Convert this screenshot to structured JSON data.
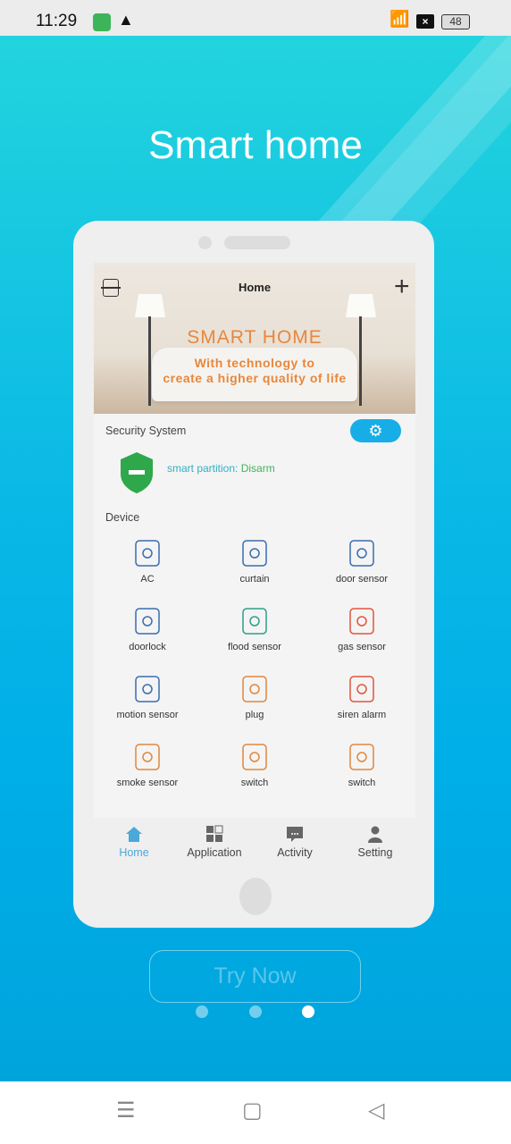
{
  "status_bar": {
    "time": "11:29",
    "battery": "48"
  },
  "title": "Smart home",
  "app": {
    "header_title": "Home",
    "banner": {
      "headline": "SMART HOME",
      "tagline_1": "With technology to",
      "tagline_2": "create a higher quality of life"
    },
    "security": {
      "label": "Security System",
      "partition_label": "smart partition:",
      "partition_state": "Disarm"
    },
    "device_label": "Device",
    "devices": [
      {
        "label": "AC",
        "icon": "ac-icon"
      },
      {
        "label": "curtain",
        "icon": "curtain-icon"
      },
      {
        "label": "door sensor",
        "icon": "door-sensor-icon"
      },
      {
        "label": "doorlock",
        "icon": "doorlock-icon"
      },
      {
        "label": "flood sensor",
        "icon": "flood-sensor-icon"
      },
      {
        "label": "gas sensor",
        "icon": "gas-sensor-icon"
      },
      {
        "label": "motion sensor",
        "icon": "motion-sensor-icon"
      },
      {
        "label": "plug",
        "icon": "plug-icon"
      },
      {
        "label": "siren alarm",
        "icon": "siren-alarm-icon"
      },
      {
        "label": "smoke sensor",
        "icon": "smoke-sensor-icon"
      },
      {
        "label": "switch",
        "icon": "switch-icon"
      },
      {
        "label": "switch",
        "icon": "switch-icon"
      }
    ],
    "tabs": [
      {
        "label": "Home",
        "active": true
      },
      {
        "label": "Application"
      },
      {
        "label": "Activity"
      },
      {
        "label": "Setting"
      }
    ]
  },
  "try_now": "Try Now",
  "pager": {
    "count": 3,
    "active": 3
  },
  "colors": {
    "accent": "#17aee7",
    "banner_text": "#e8873d",
    "armed_green": "#41b35a",
    "bg_top": "#22d4dd",
    "bg_bottom": "#00a4dc"
  }
}
